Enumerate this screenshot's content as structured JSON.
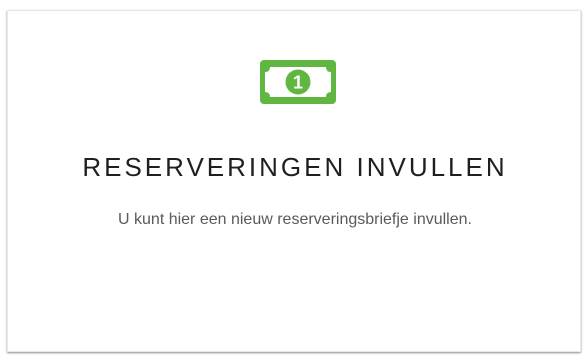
{
  "card": {
    "icon": "money-bill-icon",
    "accent_color": "#5fb741",
    "icon_digit": "1",
    "title": "RESERVERINGEN INVULLEN",
    "description": "U kunt hier een nieuw reserveringsbriefje invullen."
  }
}
